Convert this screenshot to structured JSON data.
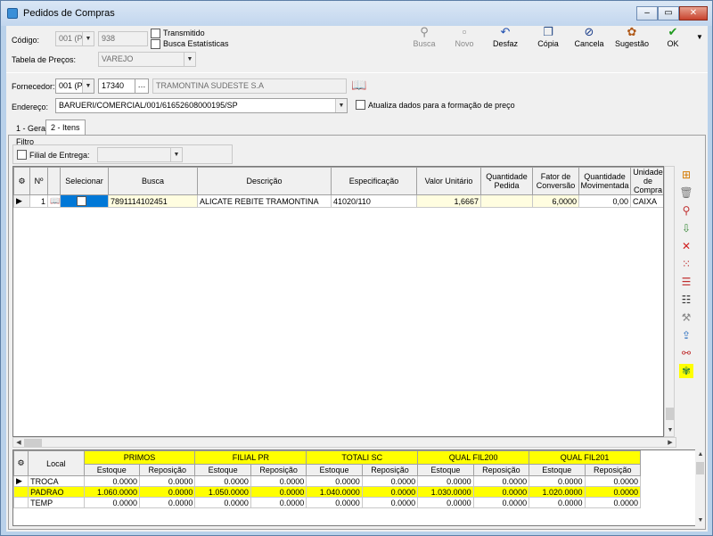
{
  "window": {
    "title": "Pedidos de Compras"
  },
  "header": {
    "codigo_label": "Código:",
    "codigo_empresa": "001 (Pl",
    "codigo_numero": "938",
    "transmitido_label": "Transmitido",
    "busca_estatisticas_label": "Busca Estatísticas",
    "tabela_precos_label": "Tabela de Preços:",
    "tabela_precos_value": "VAREJO",
    "fornecedor_label": "Fornecedor:",
    "fornecedor_empresa": "001 (Pl",
    "fornecedor_codigo": "17340",
    "fornecedor_nome": "TRAMONTINA SUDESTE S.A",
    "endereco_label": "Endereço:",
    "endereco_value": "BARUERI/COMERCIAL/001/61652608000195/SP",
    "atualiza_label": "Atualiza dados para a formação de preço"
  },
  "toolbar": {
    "busca": "Busca",
    "novo": "Novo",
    "desfaz": "Desfaz",
    "copia": "Cópia",
    "cancela": "Cancela",
    "sugestao": "Sugestão",
    "ok": "OK"
  },
  "tabs": [
    "1 - Geral",
    "2 - Itens"
  ],
  "filter": {
    "title": "Filtro",
    "filial_label": "Filial de Entrega:"
  },
  "grid": {
    "headers": [
      "Nº",
      "Selecionar",
      "Busca",
      "Descrição",
      "Especificação",
      "Valor Unitário",
      "Quantidade Pedida",
      "Fator de Conversão",
      "Quantidade Movimentada",
      "Unidade de Compra"
    ],
    "row": {
      "num": "1",
      "busca": "7891114102451",
      "descricao": "ALICATE REBITE TRAMONTINA",
      "especificacao": "41020/110",
      "valor": "1,6667",
      "qtd_pedida": "",
      "fator": "6,0000",
      "qtd_mov": "0,00",
      "unidade": "CAIXA"
    }
  },
  "stock": {
    "local_label": "Local",
    "groups": [
      "PRIMOS",
      "FILIAL PR",
      "TOTALI SC",
      "QUAL FIL200",
      "QUAL FIL201"
    ],
    "sub": [
      "Estoque",
      "Reposição"
    ],
    "rows": [
      {
        "local": "TROCA",
        "vals": [
          "0.0000",
          "0.0000",
          "0.0000",
          "0.0000",
          "0.0000",
          "0.0000",
          "0.0000",
          "0.0000",
          "0.0000",
          "0.0000"
        ]
      },
      {
        "local": "PADRAO",
        "vals": [
          "1.060.0000",
          "0.0000",
          "1.050.0000",
          "0.0000",
          "1.040.0000",
          "0.0000",
          "1.030.0000",
          "0.0000",
          "1.020.0000",
          "0.0000"
        ]
      },
      {
        "local": "TEMP",
        "vals": [
          "0.0000",
          "0.0000",
          "0.0000",
          "0.0000",
          "0.0000",
          "0.0000",
          "0.0000",
          "0.0000",
          "0.0000",
          "0.0000"
        ]
      }
    ]
  },
  "colors": {
    "highlight": "#ffff00",
    "selection": "#0078d7"
  }
}
